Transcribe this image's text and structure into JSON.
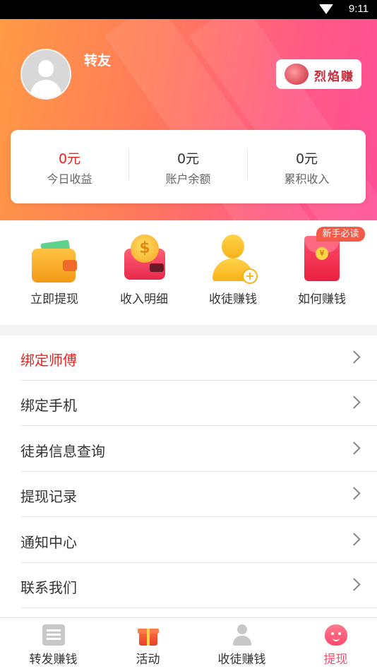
{
  "status_bar": {
    "time": "9:11"
  },
  "profile": {
    "username": "转友"
  },
  "brand": {
    "name": "烈焰赚"
  },
  "stats": [
    {
      "value": "0元",
      "label": "今日收益",
      "highlight": true
    },
    {
      "value": "0元",
      "label": "账户余额",
      "highlight": false
    },
    {
      "value": "0元",
      "label": "累积收入",
      "highlight": false
    }
  ],
  "quick_actions": [
    {
      "label": "立即提现",
      "icon": "wallet-icon"
    },
    {
      "label": "收入明细",
      "icon": "coin-purse-icon"
    },
    {
      "label": "收徒赚钱",
      "icon": "add-person-icon"
    },
    {
      "label": "如何赚钱",
      "icon": "red-envelope-icon",
      "badge": "新手必读"
    }
  ],
  "menu": [
    {
      "label": "绑定师傅",
      "highlight": true
    },
    {
      "label": "绑定手机",
      "highlight": false
    },
    {
      "label": "徒弟信息查询",
      "highlight": false
    },
    {
      "label": "提现记录",
      "highlight": false
    },
    {
      "label": "通知中心",
      "highlight": false
    },
    {
      "label": "联系我们",
      "highlight": false
    }
  ],
  "tabs": [
    {
      "label": "转发赚钱",
      "icon": "news-icon",
      "active": false
    },
    {
      "label": "活动",
      "icon": "gift-icon",
      "active": false
    },
    {
      "label": "收徒赚钱",
      "icon": "user-icon",
      "active": false
    },
    {
      "label": "提现",
      "icon": "smile-face-icon",
      "active": true
    }
  ],
  "colors": {
    "accent": "#ff4a6e",
    "highlight_red": "#e8231f",
    "header_start": "#ff9a45",
    "header_end": "#ff4f96"
  }
}
